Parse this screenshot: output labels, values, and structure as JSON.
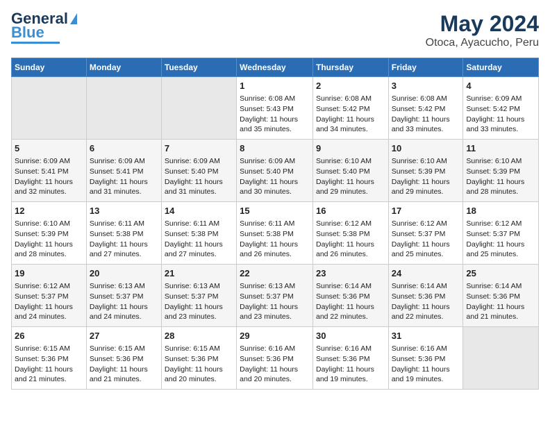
{
  "logo": {
    "part1": "General",
    "part2": "Blue"
  },
  "title": "May 2024",
  "subtitle": "Otoca, Ayacucho, Peru",
  "days_header": [
    "Sunday",
    "Monday",
    "Tuesday",
    "Wednesday",
    "Thursday",
    "Friday",
    "Saturday"
  ],
  "weeks": [
    [
      {
        "num": "",
        "info": ""
      },
      {
        "num": "",
        "info": ""
      },
      {
        "num": "",
        "info": ""
      },
      {
        "num": "1",
        "info": "Sunrise: 6:08 AM\nSunset: 5:43 PM\nDaylight: 11 hours and 35 minutes."
      },
      {
        "num": "2",
        "info": "Sunrise: 6:08 AM\nSunset: 5:42 PM\nDaylight: 11 hours and 34 minutes."
      },
      {
        "num": "3",
        "info": "Sunrise: 6:08 AM\nSunset: 5:42 PM\nDaylight: 11 hours and 33 minutes."
      },
      {
        "num": "4",
        "info": "Sunrise: 6:09 AM\nSunset: 5:42 PM\nDaylight: 11 hours and 33 minutes."
      }
    ],
    [
      {
        "num": "5",
        "info": "Sunrise: 6:09 AM\nSunset: 5:41 PM\nDaylight: 11 hours and 32 minutes."
      },
      {
        "num": "6",
        "info": "Sunrise: 6:09 AM\nSunset: 5:41 PM\nDaylight: 11 hours and 31 minutes."
      },
      {
        "num": "7",
        "info": "Sunrise: 6:09 AM\nSunset: 5:40 PM\nDaylight: 11 hours and 31 minutes."
      },
      {
        "num": "8",
        "info": "Sunrise: 6:09 AM\nSunset: 5:40 PM\nDaylight: 11 hours and 30 minutes."
      },
      {
        "num": "9",
        "info": "Sunrise: 6:10 AM\nSunset: 5:40 PM\nDaylight: 11 hours and 29 minutes."
      },
      {
        "num": "10",
        "info": "Sunrise: 6:10 AM\nSunset: 5:39 PM\nDaylight: 11 hours and 29 minutes."
      },
      {
        "num": "11",
        "info": "Sunrise: 6:10 AM\nSunset: 5:39 PM\nDaylight: 11 hours and 28 minutes."
      }
    ],
    [
      {
        "num": "12",
        "info": "Sunrise: 6:10 AM\nSunset: 5:39 PM\nDaylight: 11 hours and 28 minutes."
      },
      {
        "num": "13",
        "info": "Sunrise: 6:11 AM\nSunset: 5:38 PM\nDaylight: 11 hours and 27 minutes."
      },
      {
        "num": "14",
        "info": "Sunrise: 6:11 AM\nSunset: 5:38 PM\nDaylight: 11 hours and 27 minutes."
      },
      {
        "num": "15",
        "info": "Sunrise: 6:11 AM\nSunset: 5:38 PM\nDaylight: 11 hours and 26 minutes."
      },
      {
        "num": "16",
        "info": "Sunrise: 6:12 AM\nSunset: 5:38 PM\nDaylight: 11 hours and 26 minutes."
      },
      {
        "num": "17",
        "info": "Sunrise: 6:12 AM\nSunset: 5:37 PM\nDaylight: 11 hours and 25 minutes."
      },
      {
        "num": "18",
        "info": "Sunrise: 6:12 AM\nSunset: 5:37 PM\nDaylight: 11 hours and 25 minutes."
      }
    ],
    [
      {
        "num": "19",
        "info": "Sunrise: 6:12 AM\nSunset: 5:37 PM\nDaylight: 11 hours and 24 minutes."
      },
      {
        "num": "20",
        "info": "Sunrise: 6:13 AM\nSunset: 5:37 PM\nDaylight: 11 hours and 24 minutes."
      },
      {
        "num": "21",
        "info": "Sunrise: 6:13 AM\nSunset: 5:37 PM\nDaylight: 11 hours and 23 minutes."
      },
      {
        "num": "22",
        "info": "Sunrise: 6:13 AM\nSunset: 5:37 PM\nDaylight: 11 hours and 23 minutes."
      },
      {
        "num": "23",
        "info": "Sunrise: 6:14 AM\nSunset: 5:36 PM\nDaylight: 11 hours and 22 minutes."
      },
      {
        "num": "24",
        "info": "Sunrise: 6:14 AM\nSunset: 5:36 PM\nDaylight: 11 hours and 22 minutes."
      },
      {
        "num": "25",
        "info": "Sunrise: 6:14 AM\nSunset: 5:36 PM\nDaylight: 11 hours and 21 minutes."
      }
    ],
    [
      {
        "num": "26",
        "info": "Sunrise: 6:15 AM\nSunset: 5:36 PM\nDaylight: 11 hours and 21 minutes."
      },
      {
        "num": "27",
        "info": "Sunrise: 6:15 AM\nSunset: 5:36 PM\nDaylight: 11 hours and 21 minutes."
      },
      {
        "num": "28",
        "info": "Sunrise: 6:15 AM\nSunset: 5:36 PM\nDaylight: 11 hours and 20 minutes."
      },
      {
        "num": "29",
        "info": "Sunrise: 6:16 AM\nSunset: 5:36 PM\nDaylight: 11 hours and 20 minutes."
      },
      {
        "num": "30",
        "info": "Sunrise: 6:16 AM\nSunset: 5:36 PM\nDaylight: 11 hours and 19 minutes."
      },
      {
        "num": "31",
        "info": "Sunrise: 6:16 AM\nSunset: 5:36 PM\nDaylight: 11 hours and 19 minutes."
      },
      {
        "num": "",
        "info": ""
      }
    ]
  ]
}
